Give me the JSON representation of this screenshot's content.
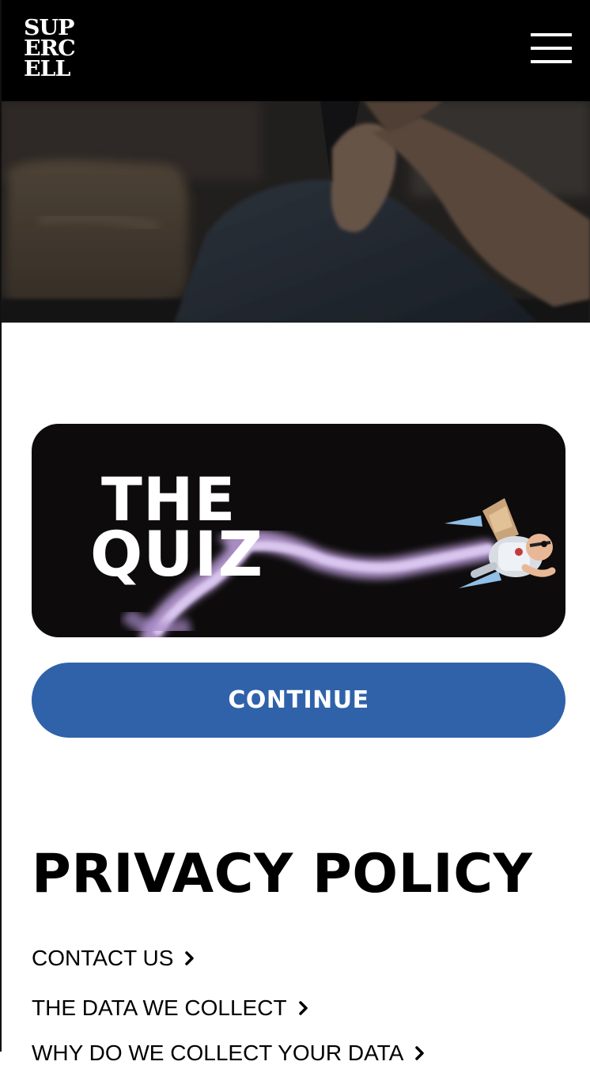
{
  "header": {
    "logo_lines": [
      "SUP",
      "ERC",
      "ELL"
    ],
    "menu_icon": "hamburger-menu-icon"
  },
  "hero": {
    "image": "person-holding-phone-photo"
  },
  "quiz": {
    "title_line1": "THE",
    "title_line2": "QUIZ",
    "character": "flying-jetpack-character",
    "smoke_color": "#c7a8e0"
  },
  "continue_button": {
    "label": "CONTINUE",
    "color": "#3062aa"
  },
  "privacy": {
    "heading": "PRIVACY POLICY",
    "links": [
      {
        "label": "CONTACT US",
        "icon": "chevron-right-icon"
      },
      {
        "label": "THE DATA WE COLLECT",
        "icon": "chevron-right-icon"
      },
      {
        "label": "WHY DO WE COLLECT YOUR DATA",
        "icon": "chevron-right-icon"
      }
    ]
  }
}
